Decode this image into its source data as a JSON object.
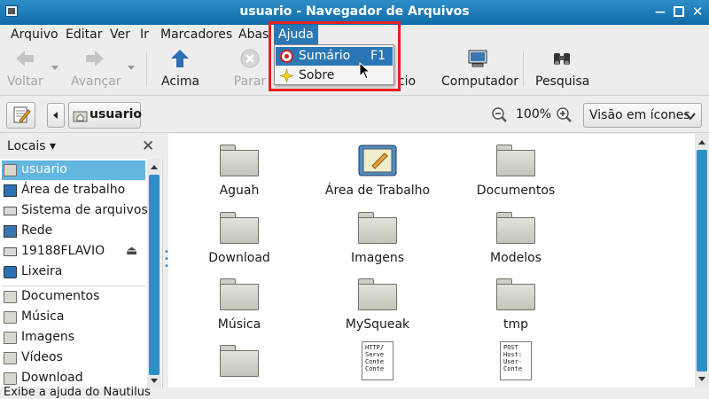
{
  "window": {
    "title": "usuario - Navegador de Arquivos"
  },
  "menubar": {
    "items": [
      "Arquivo",
      "Editar",
      "Ver",
      "Ir",
      "Marcadores",
      "Abas",
      "Ajuda"
    ],
    "active": "Ajuda"
  },
  "help_menu": {
    "items": [
      {
        "label": "Sumário",
        "accel": "F1",
        "icon": "help-lifebuoy-icon"
      },
      {
        "label": "Sobre",
        "accel": "",
        "icon": "about-star-icon"
      }
    ]
  },
  "toolbar": {
    "back": "Voltar",
    "forward": "Avançar",
    "up": "Acima",
    "stop": "Parar",
    "home_partial": "cio",
    "computer": "Computador",
    "search": "Pesquisa"
  },
  "location": {
    "crumb": "usuario",
    "zoom": "100%",
    "view_mode": "Visão em ícones"
  },
  "sidebar": {
    "header": "Locais",
    "items": [
      {
        "label": "usuario",
        "icon": "home-folder-icon",
        "selected": true
      },
      {
        "label": "Área de trabalho",
        "icon": "desktop-icon"
      },
      {
        "label": "Sistema de arquivos",
        "icon": "filesystem-icon"
      },
      {
        "label": "Rede",
        "icon": "network-icon"
      },
      {
        "label": "19188FLAVIO",
        "icon": "drive-icon",
        "eject": true
      },
      {
        "label": "Lixeira",
        "icon": "trash-icon"
      },
      {
        "label": "Documentos",
        "icon": "folder-icon"
      },
      {
        "label": "Música",
        "icon": "folder-icon"
      },
      {
        "label": "Imagens",
        "icon": "folder-icon"
      },
      {
        "label": "Vídeos",
        "icon": "folder-icon"
      },
      {
        "label": "Download",
        "icon": "folder-icon"
      }
    ]
  },
  "files": [
    {
      "name": "Aguah",
      "icon": "folder-icon"
    },
    {
      "name": "Área de Trabalho",
      "icon": "desktop-folder-icon"
    },
    {
      "name": "Documentos",
      "icon": "folder-icon"
    },
    {
      "name": "Download",
      "icon": "folder-icon"
    },
    {
      "name": "Imagens",
      "icon": "folder-icon"
    },
    {
      "name": "Modelos",
      "icon": "folder-icon"
    },
    {
      "name": "Música",
      "icon": "folder-icon"
    },
    {
      "name": "MySqueak",
      "icon": "folder-icon"
    },
    {
      "name": "tmp",
      "icon": "folder-icon"
    },
    {
      "name": "",
      "icon": "folder-icon"
    },
    {
      "name": "",
      "icon": "text-file-icon",
      "preview": "HTTP/\nServe\nConte\nConte"
    },
    {
      "name": "",
      "icon": "text-file-icon",
      "preview": "POST\nHost:\nUser-\nConte"
    }
  ],
  "status": {
    "text": "Exibe a ajuda do Nautilus"
  },
  "colors": {
    "accent": "#2b77b5",
    "titlebar": "#1a7bbd",
    "selection": "#63b6e0",
    "highlight_box": "#e52020"
  }
}
